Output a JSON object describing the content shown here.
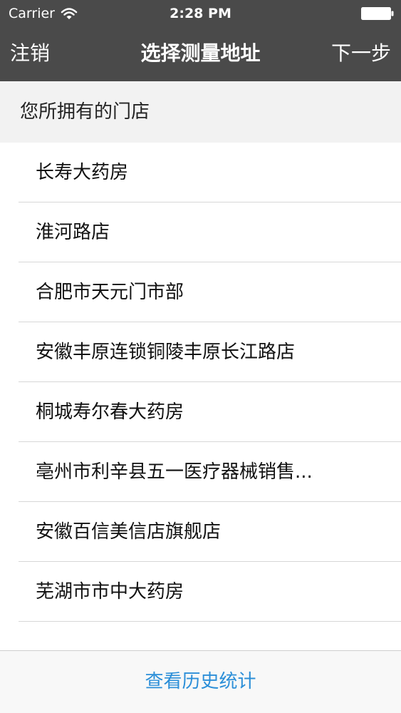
{
  "status_bar": {
    "carrier": "Carrier",
    "time": "2:28 PM"
  },
  "nav_bar": {
    "left_label": "注销",
    "title": "选择测量地址",
    "right_label": "下一步"
  },
  "section": {
    "title": "您所拥有的门店"
  },
  "stores": [
    "长寿大药房",
    "淮河路店",
    "合肥市天元门市部",
    "安徽丰原连锁铜陵丰原长江路店",
    "桐城寿尔春大药房",
    "亳州市利辛县五一医疗器械销售...",
    "安徽百信美信店旗舰店",
    "芜湖市市中大药房",
    "　"
  ],
  "bottom": {
    "history_label": "查看历史统计"
  },
  "colors": {
    "header_bg": "#4a4a4a",
    "section_bg": "#f2f2f2",
    "accent": "#2c8fd8",
    "separator": "#d7d7d7"
  }
}
